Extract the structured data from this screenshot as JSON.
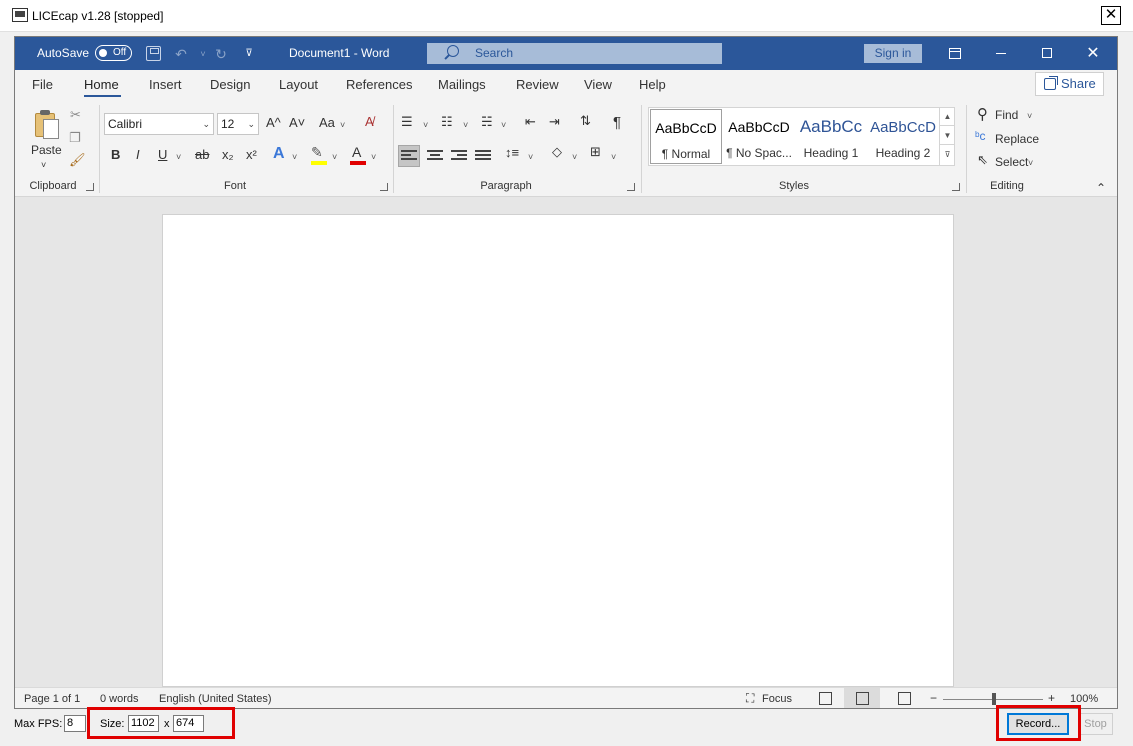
{
  "licecap": {
    "title": "LICEcap v1.28 [stopped]",
    "close_glyph": "✕",
    "max_fps_label": "Max FPS:",
    "max_fps_value": "8",
    "size_label": "Size:",
    "width_value": "1102",
    "x_sep": "x",
    "height_value": "674",
    "record_label": "Record...",
    "stop_label": "Stop",
    "highlight_color": "#e00000"
  },
  "word": {
    "autosave_label": "AutoSave",
    "autosave_state": "Off",
    "doc_title": "Document1  -  Word",
    "search_placeholder": "Search",
    "signin_label": "Sign in",
    "brand_color": "#2b579a",
    "tabs": [
      "File",
      "Home",
      "Insert",
      "Design",
      "Layout",
      "References",
      "Mailings",
      "Review",
      "View",
      "Help"
    ],
    "share_label": "Share",
    "clipboard": {
      "paste_label": "Paste",
      "group_label": "Clipboard"
    },
    "font": {
      "name": "Calibri",
      "size": "12",
      "group_label": "Font",
      "grow": "A^",
      "shrink": "A˅",
      "case": "Aa",
      "bold": "B",
      "italic": "I",
      "underline": "U",
      "strike": "ab",
      "subscript": "x₂",
      "superscript": "x²"
    },
    "paragraph": {
      "group_label": "Paragraph",
      "pilcrow": "¶"
    },
    "styles": {
      "group_label": "Styles",
      "items": [
        {
          "preview": "AaBbCcD",
          "name": "¶ Normal"
        },
        {
          "preview": "AaBbCcD",
          "name": "¶ No Spac..."
        },
        {
          "preview": "AaBbCc",
          "name": "Heading 1"
        },
        {
          "preview": "AaBbCcD",
          "name": "Heading 2"
        }
      ]
    },
    "editing": {
      "find": "Find",
      "replace": "Replace",
      "select": "Select",
      "group_label": "Editing"
    },
    "status": {
      "page": "Page 1 of 1",
      "words": "0 words",
      "language": "English (United States)",
      "focus": "Focus",
      "zoom_minus": "−",
      "zoom_plus": "+",
      "zoom": "100%"
    }
  }
}
